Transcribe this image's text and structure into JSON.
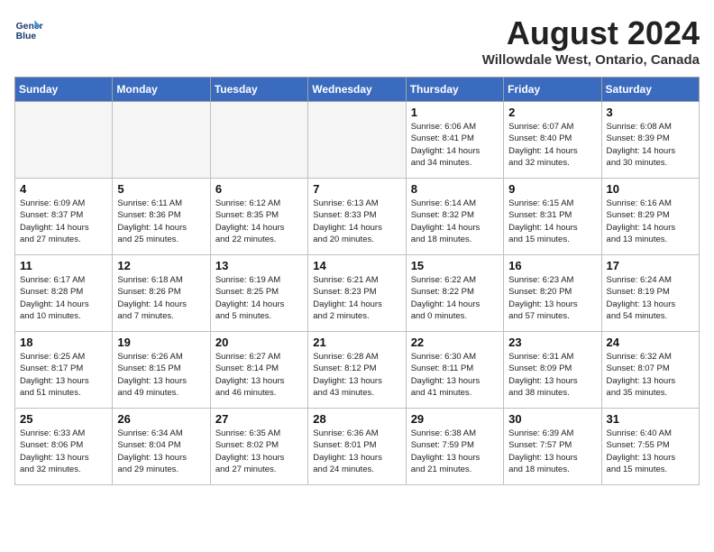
{
  "header": {
    "logo_line1": "General",
    "logo_line2": "Blue",
    "month_title": "August 2024",
    "location": "Willowdale West, Ontario, Canada"
  },
  "days_of_week": [
    "Sunday",
    "Monday",
    "Tuesday",
    "Wednesday",
    "Thursday",
    "Friday",
    "Saturday"
  ],
  "weeks": [
    [
      {
        "day": "",
        "text": ""
      },
      {
        "day": "",
        "text": ""
      },
      {
        "day": "",
        "text": ""
      },
      {
        "day": "",
        "text": ""
      },
      {
        "day": "1",
        "text": "Sunrise: 6:06 AM\nSunset: 8:41 PM\nDaylight: 14 hours\nand 34 minutes."
      },
      {
        "day": "2",
        "text": "Sunrise: 6:07 AM\nSunset: 8:40 PM\nDaylight: 14 hours\nand 32 minutes."
      },
      {
        "day": "3",
        "text": "Sunrise: 6:08 AM\nSunset: 8:39 PM\nDaylight: 14 hours\nand 30 minutes."
      }
    ],
    [
      {
        "day": "4",
        "text": "Sunrise: 6:09 AM\nSunset: 8:37 PM\nDaylight: 14 hours\nand 27 minutes."
      },
      {
        "day": "5",
        "text": "Sunrise: 6:11 AM\nSunset: 8:36 PM\nDaylight: 14 hours\nand 25 minutes."
      },
      {
        "day": "6",
        "text": "Sunrise: 6:12 AM\nSunset: 8:35 PM\nDaylight: 14 hours\nand 22 minutes."
      },
      {
        "day": "7",
        "text": "Sunrise: 6:13 AM\nSunset: 8:33 PM\nDaylight: 14 hours\nand 20 minutes."
      },
      {
        "day": "8",
        "text": "Sunrise: 6:14 AM\nSunset: 8:32 PM\nDaylight: 14 hours\nand 18 minutes."
      },
      {
        "day": "9",
        "text": "Sunrise: 6:15 AM\nSunset: 8:31 PM\nDaylight: 14 hours\nand 15 minutes."
      },
      {
        "day": "10",
        "text": "Sunrise: 6:16 AM\nSunset: 8:29 PM\nDaylight: 14 hours\nand 13 minutes."
      }
    ],
    [
      {
        "day": "11",
        "text": "Sunrise: 6:17 AM\nSunset: 8:28 PM\nDaylight: 14 hours\nand 10 minutes."
      },
      {
        "day": "12",
        "text": "Sunrise: 6:18 AM\nSunset: 8:26 PM\nDaylight: 14 hours\nand 7 minutes."
      },
      {
        "day": "13",
        "text": "Sunrise: 6:19 AM\nSunset: 8:25 PM\nDaylight: 14 hours\nand 5 minutes."
      },
      {
        "day": "14",
        "text": "Sunrise: 6:21 AM\nSunset: 8:23 PM\nDaylight: 14 hours\nand 2 minutes."
      },
      {
        "day": "15",
        "text": "Sunrise: 6:22 AM\nSunset: 8:22 PM\nDaylight: 14 hours\nand 0 minutes."
      },
      {
        "day": "16",
        "text": "Sunrise: 6:23 AM\nSunset: 8:20 PM\nDaylight: 13 hours\nand 57 minutes."
      },
      {
        "day": "17",
        "text": "Sunrise: 6:24 AM\nSunset: 8:19 PM\nDaylight: 13 hours\nand 54 minutes."
      }
    ],
    [
      {
        "day": "18",
        "text": "Sunrise: 6:25 AM\nSunset: 8:17 PM\nDaylight: 13 hours\nand 51 minutes."
      },
      {
        "day": "19",
        "text": "Sunrise: 6:26 AM\nSunset: 8:15 PM\nDaylight: 13 hours\nand 49 minutes."
      },
      {
        "day": "20",
        "text": "Sunrise: 6:27 AM\nSunset: 8:14 PM\nDaylight: 13 hours\nand 46 minutes."
      },
      {
        "day": "21",
        "text": "Sunrise: 6:28 AM\nSunset: 8:12 PM\nDaylight: 13 hours\nand 43 minutes."
      },
      {
        "day": "22",
        "text": "Sunrise: 6:30 AM\nSunset: 8:11 PM\nDaylight: 13 hours\nand 41 minutes."
      },
      {
        "day": "23",
        "text": "Sunrise: 6:31 AM\nSunset: 8:09 PM\nDaylight: 13 hours\nand 38 minutes."
      },
      {
        "day": "24",
        "text": "Sunrise: 6:32 AM\nSunset: 8:07 PM\nDaylight: 13 hours\nand 35 minutes."
      }
    ],
    [
      {
        "day": "25",
        "text": "Sunrise: 6:33 AM\nSunset: 8:06 PM\nDaylight: 13 hours\nand 32 minutes."
      },
      {
        "day": "26",
        "text": "Sunrise: 6:34 AM\nSunset: 8:04 PM\nDaylight: 13 hours\nand 29 minutes."
      },
      {
        "day": "27",
        "text": "Sunrise: 6:35 AM\nSunset: 8:02 PM\nDaylight: 13 hours\nand 27 minutes."
      },
      {
        "day": "28",
        "text": "Sunrise: 6:36 AM\nSunset: 8:01 PM\nDaylight: 13 hours\nand 24 minutes."
      },
      {
        "day": "29",
        "text": "Sunrise: 6:38 AM\nSunset: 7:59 PM\nDaylight: 13 hours\nand 21 minutes."
      },
      {
        "day": "30",
        "text": "Sunrise: 6:39 AM\nSunset: 7:57 PM\nDaylight: 13 hours\nand 18 minutes."
      },
      {
        "day": "31",
        "text": "Sunrise: 6:40 AM\nSunset: 7:55 PM\nDaylight: 13 hours\nand 15 minutes."
      }
    ]
  ]
}
